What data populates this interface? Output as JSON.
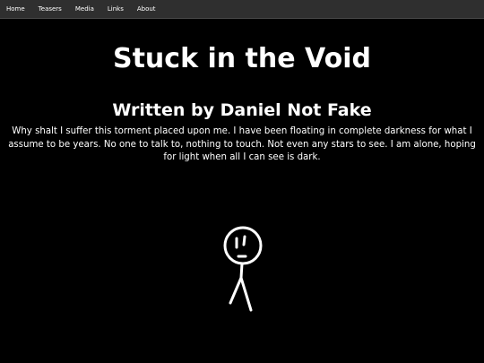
{
  "nav": {
    "items": [
      "Home",
      "Teasers",
      "Media",
      "Links",
      "About"
    ]
  },
  "page": {
    "title": "Stuck in the Void",
    "author": "Written by Daniel Not Fake",
    "story": "Why shalt I suffer this torment placed upon me. I have been floating in complete darkness for what I assume to be years. No one to talk to, nothing to touch. Not even any stars to see. I am alone, hoping for light when all I can see is dark."
  },
  "colors": {
    "background": "#000000",
    "navbar": "#2f2f2f",
    "text": "#ffffff"
  },
  "icons": {
    "figure": "stick-figure-drawing"
  }
}
